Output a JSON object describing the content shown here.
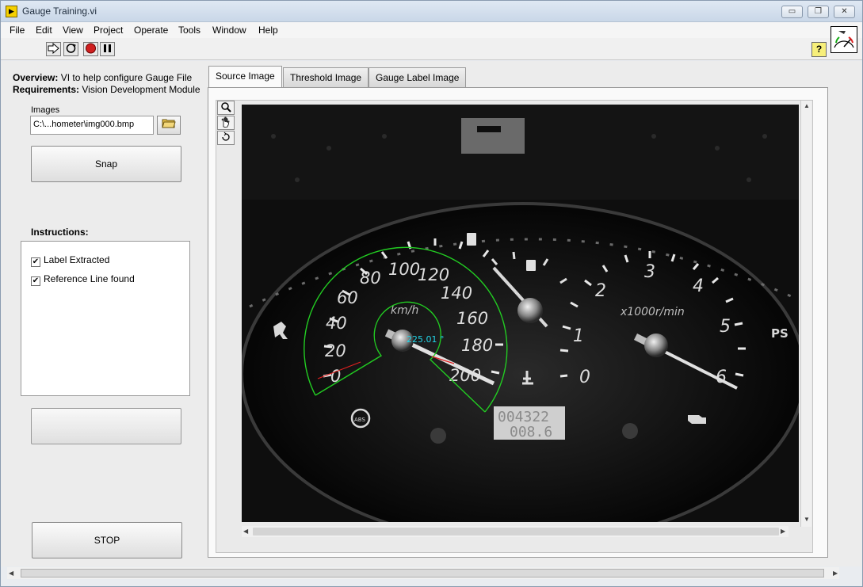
{
  "window": {
    "title": "Gauge Training.vi",
    "controls": {
      "minimize": "▭",
      "restore": "❐",
      "close": "✕"
    }
  },
  "menu": [
    "File",
    "Edit",
    "View",
    "Project",
    "Operate",
    "Tools",
    "Window",
    "Help"
  ],
  "toolbar": {
    "run_icon": "run-arrow-icon",
    "run_continuous_icon": "run-continuously-icon",
    "abort_icon": "abort-stop-icon",
    "pause_icon": "pause-icon",
    "help_label": "?"
  },
  "panel": {
    "overview_label": "Overview:",
    "overview_text": "VI to help configure Gauge File",
    "requirements_label": "Requirements:",
    "requirements_text": "Vision Development Module",
    "images_label": "Images",
    "images_path": "C:\\...hometer\\img000.bmp",
    "snap_label": "Snap",
    "instructions_label": "Instructions:",
    "instructions": [
      {
        "label": "Label Extracted",
        "checked": true
      },
      {
        "label": "Reference Line found",
        "checked": true
      }
    ],
    "blank_button_label": "",
    "stop_label": "STOP"
  },
  "tabs": [
    {
      "label": "Source Image",
      "active": true
    },
    {
      "label": "Threshold Image",
      "active": false
    },
    {
      "label": "Gauge Label Image",
      "active": false
    }
  ],
  "image_tools": [
    "zoom-icon",
    "pan-hand-icon",
    "rotate-icon"
  ],
  "gauge": {
    "angle_readout": "225.01 °",
    "speed_unit": "km/h",
    "rpm_unit": "x1000r/min",
    "speed_ticks": [
      "0",
      "20",
      "40",
      "60",
      "80",
      "100",
      "120",
      "140",
      "160",
      "180",
      "200"
    ],
    "rpm_ticks": [
      "0",
      "1",
      "2",
      "3",
      "4",
      "5",
      "6"
    ],
    "odometer": "004322",
    "trip": "008.6",
    "ps_label": "PS",
    "accent_green": "#22cc22",
    "readout_cyan": "#22d5e8",
    "reference_red": "#e02020"
  }
}
